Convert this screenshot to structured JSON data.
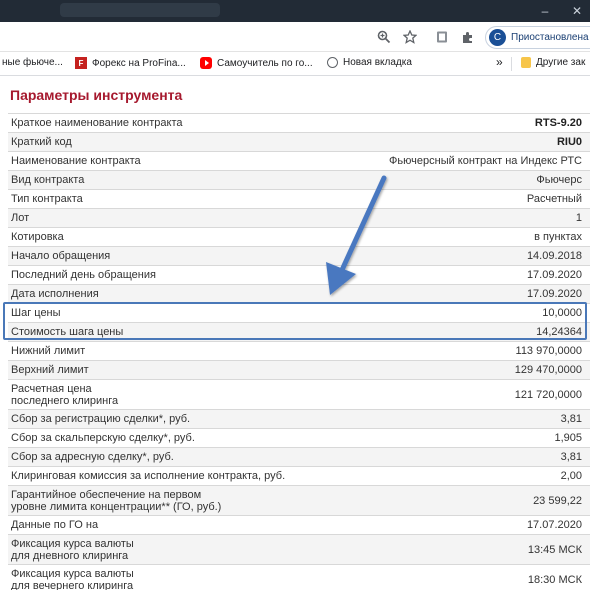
{
  "browser": {
    "window_controls": {
      "minimize": "–",
      "close": "✕"
    },
    "toolbar": {
      "profile_initial": "С",
      "profile_status": "Приостановлена"
    },
    "bookmarks": [
      {
        "label": "ные фьюче...",
        "icon": "none"
      },
      {
        "label": "Форекс на ProFina...",
        "icon": "profinance-icon"
      },
      {
        "label": "Самоучитель по го...",
        "icon": "youtube-icon"
      },
      {
        "label": "Новая вкладка",
        "icon": "globe-icon"
      }
    ],
    "bookmarks_more": "»",
    "other_bookmarks": "Другие зак"
  },
  "page": {
    "title": "Параметры инструмента",
    "accent_color": "#a6192e",
    "highlight_color": "#4a78b8",
    "rows": [
      {
        "label": "Краткое наименование контракта",
        "value": "RTS-9.20",
        "bold": true
      },
      {
        "label": "Краткий код",
        "value": "RIU0",
        "bold": true
      },
      {
        "label": "Наименование контракта",
        "value": "Фьючерсный контракт на Индекс РТС"
      },
      {
        "label": "Вид контракта",
        "value": "Фьючерс"
      },
      {
        "label": "Тип контракта",
        "value": "Расчетный"
      },
      {
        "label": "Лот",
        "value": "1"
      },
      {
        "label": "Котировка",
        "value": "в пунктах"
      },
      {
        "label": "Начало обращения",
        "value": "14.09.2018"
      },
      {
        "label": "Последний день обращения",
        "value": "17.09.2020"
      },
      {
        "label": "Дата исполнения",
        "value": "17.09.2020"
      },
      {
        "label": "Шаг цены",
        "value": "10,0000"
      },
      {
        "label": "Стоимость шага цены",
        "value": "14,24364"
      },
      {
        "label": "Нижний лимит",
        "value": "113 970,0000"
      },
      {
        "label": "Верхний лимит",
        "value": "129 470,0000"
      },
      {
        "label": "Расчетная цена\nпоследнего клиринга",
        "value": "121 720,0000"
      },
      {
        "label": "Сбор за регистрацию сделки*, руб.",
        "value": "3,81"
      },
      {
        "label": "Сбор за скальперскую сделку*, руб.",
        "value": "1,905"
      },
      {
        "label": "Сбор за адресную сделку*, руб.",
        "value": "3,81"
      },
      {
        "label": "Клиринговая комиссия за исполнение контракта, руб.",
        "value": "2,00"
      },
      {
        "label": "Гарантийное обеспечение на первом\nуровне лимита концентрации** (ГО, руб.)",
        "value": "23 599,22"
      },
      {
        "label": "Данные по ГО на",
        "value": "17.07.2020"
      },
      {
        "label": "Фиксация курса валюты\nдля дневного клиринга",
        "value": "13:45 МСК"
      },
      {
        "label": "Фиксация курса валюты\nдля вечернего клиринга",
        "value": "18:30 МСК"
      }
    ]
  }
}
